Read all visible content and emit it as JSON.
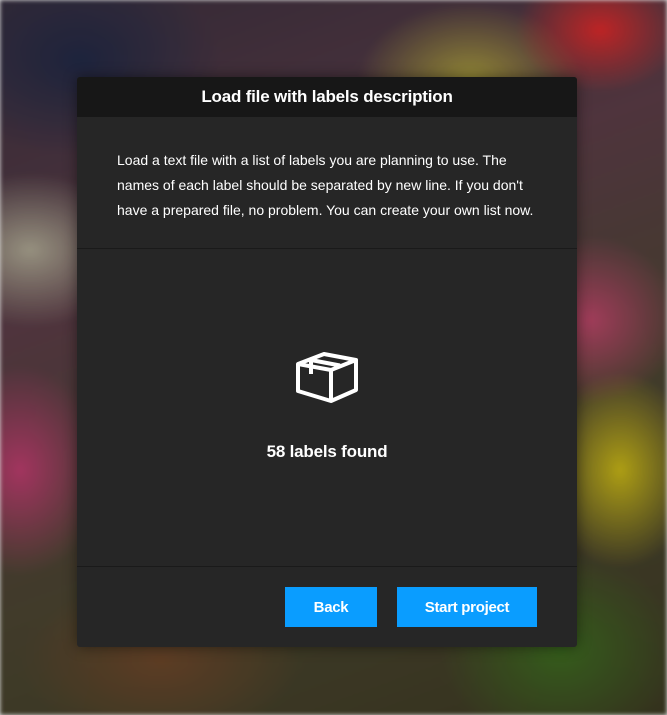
{
  "modal": {
    "title": "Load file with labels description",
    "description": "Load a text file with a list of labels you are planning to use. The names of each label should be separated by new line. If you don't have a prepared file, no problem. You can create your own list now.",
    "icon": "box-icon",
    "status": "58 labels found"
  },
  "footer": {
    "back_label": "Back",
    "start_label": "Start project"
  },
  "colors": {
    "accent": "#0a9dff",
    "modal_bg": "#262626",
    "header_bg": "#171717"
  }
}
